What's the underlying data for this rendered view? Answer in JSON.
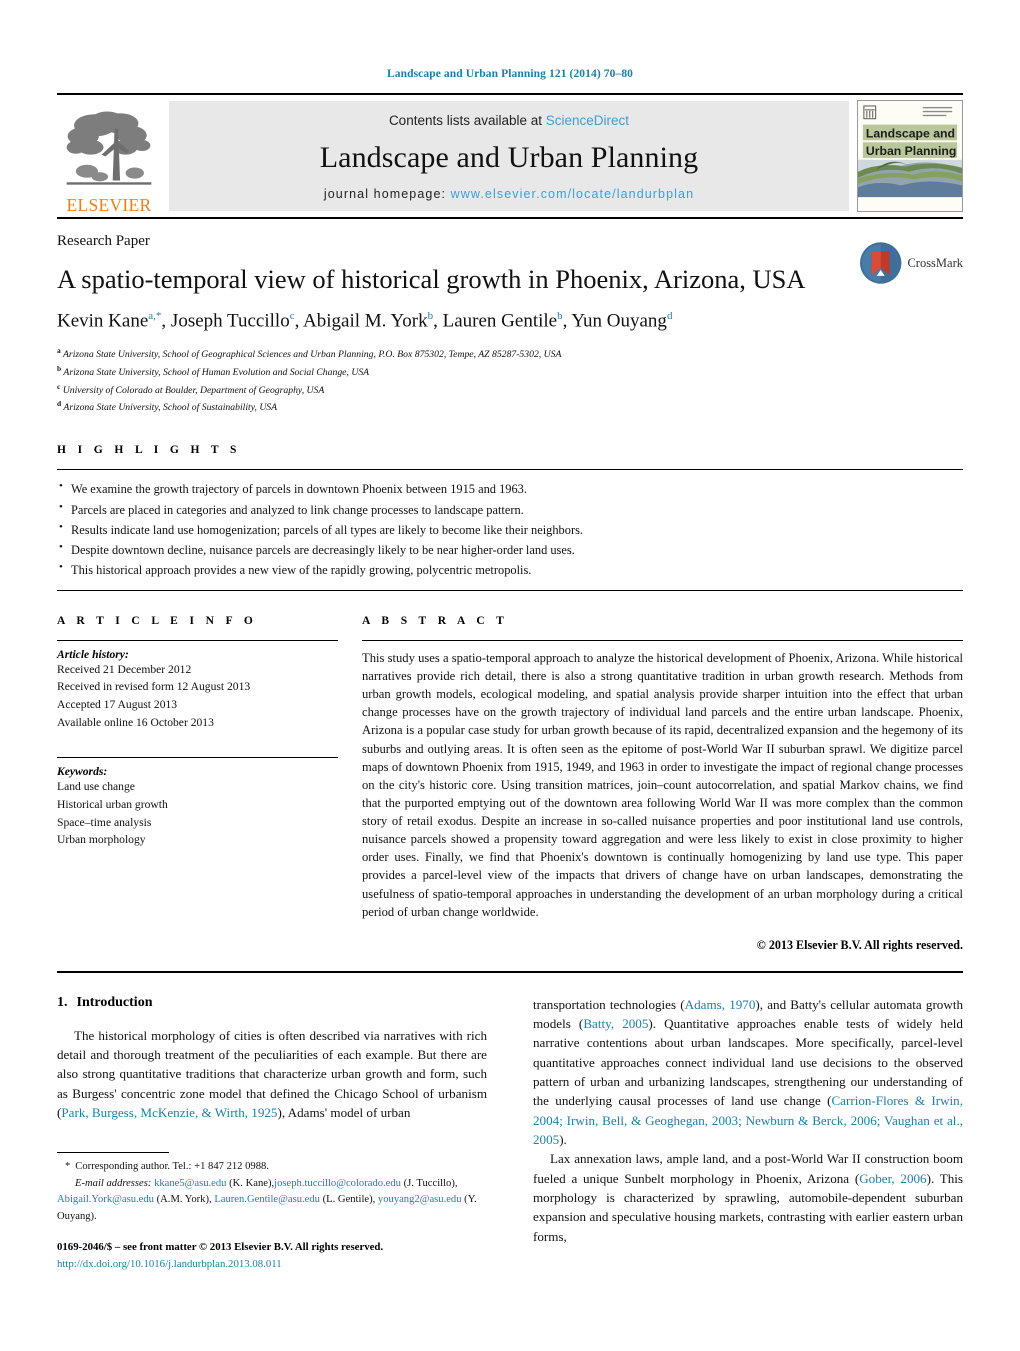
{
  "running_head": "Landscape and Urban Planning 121 (2014) 70–80",
  "masthead": {
    "publisher_logo_text": "ELSEVIER",
    "contents_prefix": "Contents lists available at ",
    "contents_link": "ScienceDirect",
    "journal_title": "Landscape and Urban Planning",
    "homepage_prefix": "journal homepage: ",
    "homepage_url": "www.elsevier.com/locate/landurbplan",
    "cover": {
      "line1": "Landscape and",
      "line2": "Urban Planning"
    },
    "accent_link_color": "#3c9fd6",
    "band_color": "#e8e8e8",
    "elsevier_orange": "#f07f13"
  },
  "article": {
    "section_type": "Research Paper",
    "title": "A spatio-temporal view of historical growth in Phoenix, Arizona, USA",
    "crossmark_label": "CrossMark",
    "authors_html": "Kevin Kane<sup>a,*</sup>, Joseph Tuccillo<sup>c</sup>, Abigail M. York<sup>b</sup>, Lauren Gentile<sup>b</sup>, Yun Ouyang<sup>d</sup>",
    "affiliations": [
      {
        "marker": "a",
        "text": "Arizona State University, School of Geographical Sciences and Urban Planning, P.O. Box 875302, Tempe, AZ 85287-5302, USA"
      },
      {
        "marker": "b",
        "text": "Arizona State University, School of Human Evolution and Social Change, USA"
      },
      {
        "marker": "c",
        "text": "University of Colorado at Boulder, Department of Geography, USA"
      },
      {
        "marker": "d",
        "text": "Arizona State University, School of Sustainability, USA"
      }
    ]
  },
  "highlights": {
    "heading": "H I G H L I G H T S",
    "items": [
      "We examine the growth trajectory of parcels in downtown Phoenix between 1915 and 1963.",
      "Parcels are placed in categories and analyzed to link change processes to landscape pattern.",
      "Results indicate land use homogenization; parcels of all types are likely to become like their neighbors.",
      "Despite downtown decline, nuisance parcels are decreasingly likely to be near higher-order land uses.",
      "This historical approach provides a new view of the rapidly growing, polycentric metropolis."
    ]
  },
  "article_info": {
    "heading": "A R T I C L E    I N F O",
    "history_label": "Article history:",
    "history": [
      "Received 21 December 2012",
      "Received in revised form 12 August 2013",
      "Accepted 17 August 2013",
      "Available online 16 October 2013"
    ],
    "keywords_label": "Keywords:",
    "keywords": [
      "Land use change",
      "Historical urban growth",
      "Space–time analysis",
      "Urban morphology"
    ]
  },
  "abstract": {
    "heading": "A B S T R A C T",
    "text": "This study uses a spatio-temporal approach to analyze the historical development of Phoenix, Arizona. While historical narratives provide rich detail, there is also a strong quantitative tradition in urban growth research. Methods from urban growth models, ecological modeling, and spatial analysis provide sharper intuition into the effect that urban change processes have on the growth trajectory of individual land parcels and the entire urban landscape. Phoenix, Arizona is a popular case study for urban growth because of its rapid, decentralized expansion and the hegemony of its suburbs and outlying areas. It is often seen as the epitome of post-World War II suburban sprawl. We digitize parcel maps of downtown Phoenix from 1915, 1949, and 1963 in order to investigate the impact of regional change processes on the city's historic core. Using transition matrices, join–count autocorrelation, and spatial Markov chains, we find that the purported emptying out of the downtown area following World War II was more complex than the common story of retail exodus. Despite an increase in so-called nuisance properties and poor institutional land use controls, nuisance parcels showed a propensity toward aggregation and were less likely to exist in close proximity to higher order uses. Finally, we find that Phoenix's downtown is continually homogenizing by land use type. This paper provides a parcel-level view of the impacts that drivers of change have on urban landscapes, demonstrating the usefulness of spatio-temporal approaches in understanding the development of an urban morphology during a critical period of urban change worldwide.",
    "copyright": "© 2013 Elsevier B.V. All rights reserved."
  },
  "body": {
    "section_number": "1.",
    "section_title": "Introduction",
    "left_para_1_a": "The historical morphology of cities is often described via narratives with rich detail and thorough treatment of the peculiarities of each example. But there are also strong quantitative traditions that characterize urban growth and form, such as Burgess' concentric zone model that defined the Chicago School of urbanism (",
    "left_cite_1": "Park, Burgess, McKenzie, & Wirth, 1925",
    "left_para_1_b": "), Adams' model of urban",
    "right_para_1_a": "transportation technologies (",
    "right_cite_1": "Adams, 1970",
    "right_para_1_b": "), and Batty's cellular automata growth models (",
    "right_cite_2": "Batty, 2005",
    "right_para_1_c": "). Quantitative approaches enable tests of widely held narrative contentions about urban landscapes. More specifically, parcel-level quantitative approaches connect individual land use decisions to the observed pattern of urban and urbanizing landscapes, strengthening our understanding of the underlying causal processes of land use change (",
    "right_cite_3": "Carrion-Flores & Irwin, 2004; Irwin, Bell, & Geoghegan, 2003; Newburn & Berck, 2006; Vaughan et al., 2005",
    "right_para_1_d": ").",
    "right_para_2_a": "Lax annexation laws, ample land, and a post-World War II construction boom fueled a unique Sunbelt morphology in Phoenix, Arizona (",
    "right_cite_4": "Gober, 2006",
    "right_para_2_b": "). This morphology is characterized by sprawling, automobile-dependent suburban expansion and speculative housing markets, contrasting with earlier eastern urban forms,"
  },
  "footnotes": {
    "corresponding": "Corresponding author. Tel.: +1 847 212 0988.",
    "email_label": "E-mail addresses:",
    "emails": [
      {
        "address": "kkane5@asu.edu",
        "name": " (K. Kane),"
      },
      {
        "address": "joseph.tuccillo@colorado.edu",
        "name": " (J. Tuccillo), "
      },
      {
        "address": "Abigail.York@asu.edu",
        "name": " (A.M. York), "
      },
      {
        "address": "Lauren.Gentile@asu.edu",
        "name": " (L. Gentile), "
      },
      {
        "address": "youyang2@asu.edu",
        "name": " (Y. Ouyang)."
      }
    ],
    "issn_line": "0169-2046/$ – see front matter © 2013 Elsevier B.V. All rights reserved.",
    "doi": "http://dx.doi.org/10.1016/j.landurbplan.2013.08.011"
  }
}
